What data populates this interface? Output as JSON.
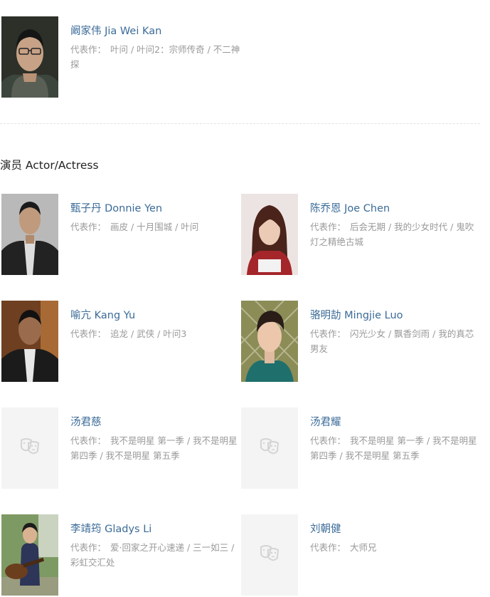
{
  "label_prefix": "代表作：",
  "director": {
    "name": "阚家伟 Jia Wei Kan",
    "works": "叶问 / 叶问2：宗师传奇 / 不二神探"
  },
  "cast_section": {
    "title": "演员 Actor/Actress"
  },
  "cast": [
    {
      "name": "甄子丹 Donnie Yen",
      "works": "画皮 / 十月围城 / 叶问"
    },
    {
      "name": "陈乔恩 Joe Chen",
      "works": "后会无期 / 我的少女时代 / 鬼吹灯之精绝古城"
    },
    {
      "name": "喻亢 Kang Yu",
      "works": "追龙 / 武侠 / 叶问3"
    },
    {
      "name": "骆明劼 Mingjie Luo",
      "works": "闪光少女 / 飘香剑雨 / 我的真芯男友"
    },
    {
      "name": "汤君慈",
      "works": "我不是明星 第一季 / 我不是明星 第四季 / 我不是明星 第五季"
    },
    {
      "name": "汤君耀",
      "works": "我不是明星 第一季 / 我不是明星 第四季 / 我不是明星 第五季"
    },
    {
      "name": "李靖筠 Gladys Li",
      "works": "爱·回家之开心速递 / 三一如三 / 彩虹交汇处"
    },
    {
      "name": "刘朝健",
      "works": "大师兄"
    }
  ],
  "colors": {
    "link": "#3b6b98",
    "muted": "#999999",
    "placeholder_bg": "#f4f4f4"
  }
}
